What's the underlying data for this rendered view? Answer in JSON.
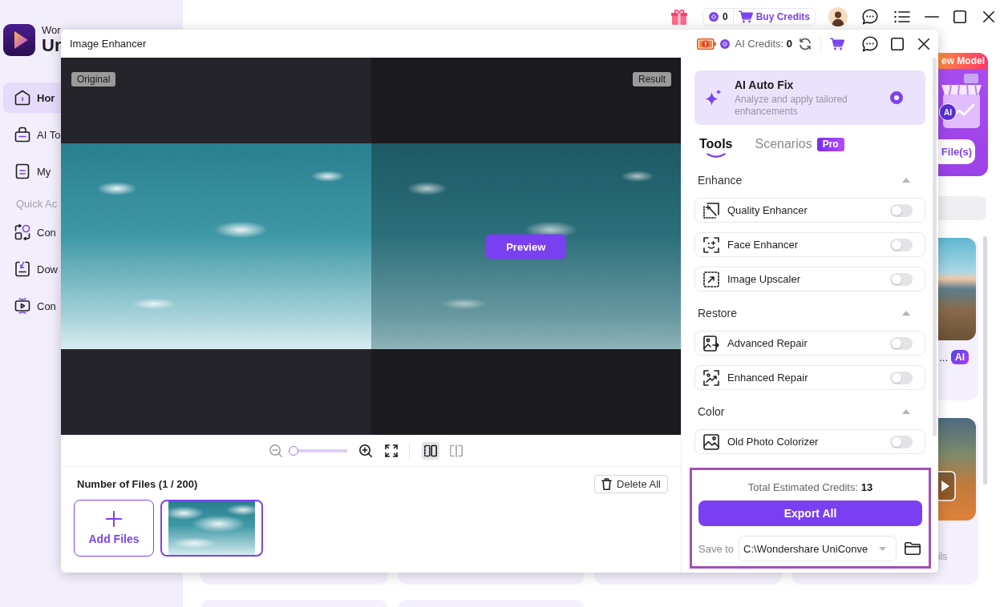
{
  "app": {
    "logo": {
      "line_1": "Wor",
      "line_2": "Ur"
    },
    "nav": [
      {
        "label": "Hor",
        "selected": true
      },
      {
        "label": "AI To",
        "selected": false
      },
      {
        "label": "My",
        "selected": false
      }
    ],
    "quick_actions_heading": "Quick Ac",
    "quick_actions": [
      {
        "label": "Con"
      },
      {
        "label": "Dow"
      },
      {
        "label": "Con"
      }
    ],
    "top_bar": {
      "credits": "0",
      "buy_credits": "Buy Credits"
    },
    "promo": {
      "badge": "ew Model",
      "illustration_badge": "AI",
      "button": "File(s)"
    },
    "cards": [
      {
        "title": "...",
        "badge": "AI"
      },
      {
        "caption": "ils"
      }
    ]
  },
  "dialog": {
    "title": "Image Enhancer",
    "ai_credits": "AI Credits: **0**",
    "preview": {
      "original_label": "Original",
      "result_label": "Result",
      "button": "Preview"
    },
    "zoom": {
      "level": 0
    },
    "view_modes": [
      {
        "selected": true
      },
      {
        "selected": false
      }
    ],
    "files": {
      "count": "Number of Files (1 / 200)",
      "delete_all": "Delete All",
      "add_files": "Add Files",
      "thumbnails": [
        {
          "selected": true
        }
      ]
    },
    "auto_fix": {
      "title": "AI Auto Fix",
      "description": "Analyze and apply tailored enhancements",
      "selected": true
    },
    "tabs": [
      {
        "label": "Tools",
        "selected": true
      },
      {
        "label": "Scenarios",
        "badge": "Pro",
        "selected": false
      }
    ],
    "sections": [
      {
        "title": "Enhance",
        "expanded": true,
        "tools": [
          {
            "label": "Quality Enhancer",
            "on": false
          },
          {
            "label": "Face Enhancer",
            "on": false
          },
          {
            "label": "Image Upscaler",
            "on": false
          }
        ]
      },
      {
        "title": "Restore",
        "expanded": true,
        "tools": [
          {
            "label": "Advanced Repair",
            "on": false
          },
          {
            "label": "Enhanced Repair",
            "on": false
          }
        ]
      },
      {
        "title": "Color",
        "expanded": true,
        "tools": [
          {
            "label": "Old Photo Colorizer",
            "on": false
          }
        ]
      }
    ],
    "export": {
      "credits": "Total Estimated Credits: **13**",
      "button": "Export All",
      "save_label": "Save to",
      "path": "C:\\Wondershare UniConve"
    }
  }
}
